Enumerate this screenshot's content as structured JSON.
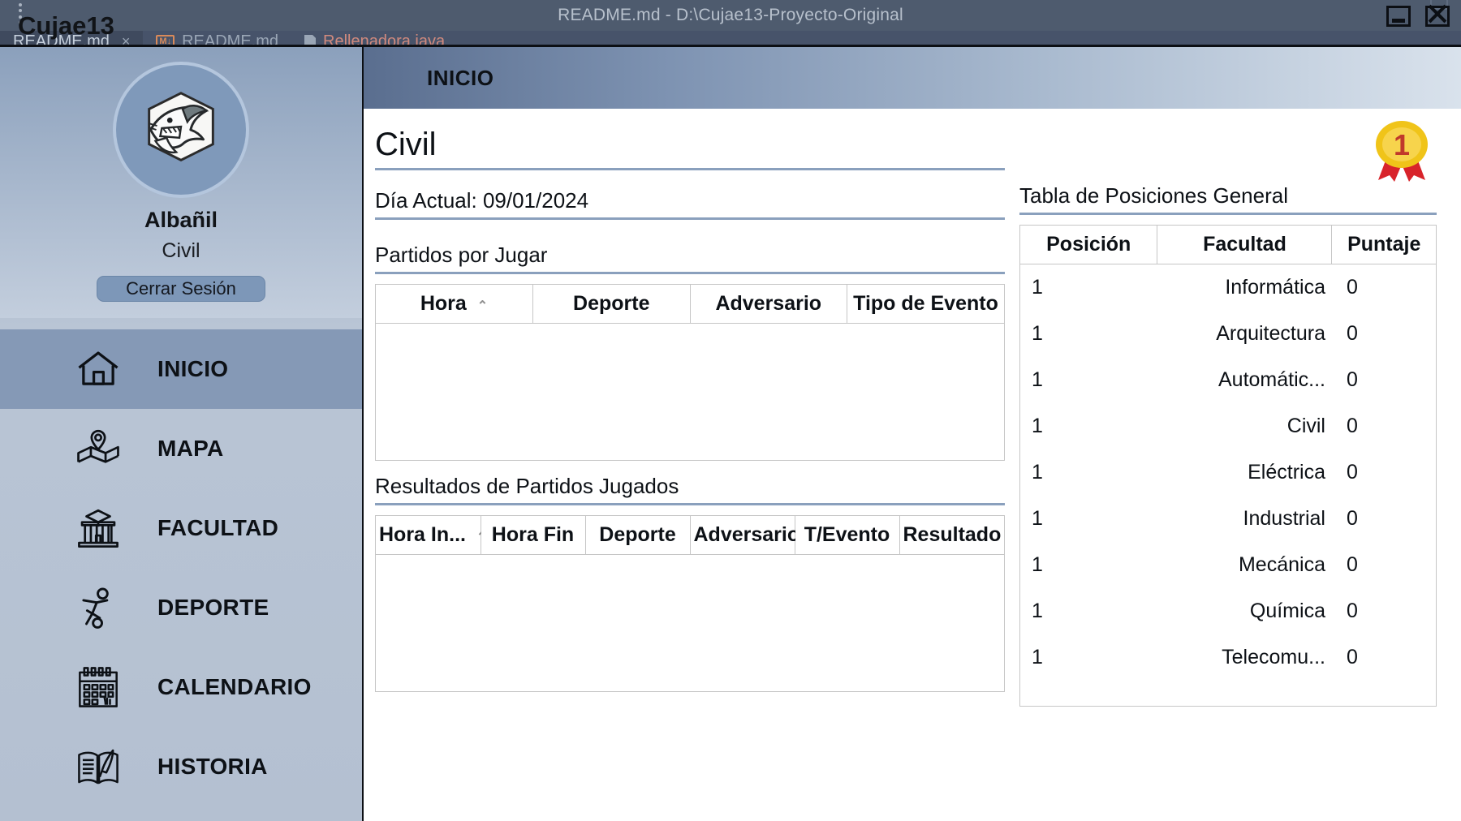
{
  "ide": {
    "title": "README.md - D:\\Cujae13-Proyecto-Original",
    "project_label": "Cujae13",
    "kebab_icon": "more-vertical-icon",
    "window_buttons": {
      "minimize": "minimize-icon",
      "close": "close-icon"
    },
    "tabs": [
      {
        "label": "README.md",
        "icon": "",
        "close": "×",
        "active": true
      },
      {
        "label": "README.md",
        "icon": "md-icon",
        "close": "",
        "active": false
      },
      {
        "label": "Rellenadora.java",
        "icon": "java-file-icon",
        "close": "",
        "active": false
      }
    ]
  },
  "sidebar": {
    "avatar_icon": "shark-logo",
    "profile_name": "Albañil",
    "profile_faculty": "Civil",
    "logout_label": "Cerrar Sesión",
    "items": [
      {
        "label": "INICIO",
        "icon": "home-icon",
        "active": true
      },
      {
        "label": "MAPA",
        "icon": "map-icon",
        "active": false
      },
      {
        "label": "FACULTAD",
        "icon": "university-icon",
        "active": false
      },
      {
        "label": "DEPORTE",
        "icon": "soccer-player-icon",
        "active": false
      },
      {
        "label": "CALENDARIO",
        "icon": "calendar-icon",
        "active": false
      },
      {
        "label": "HISTORIA",
        "icon": "book-quill-icon",
        "active": false
      }
    ]
  },
  "content": {
    "header_title": "INICIO",
    "page_title": "Civil",
    "current_day": "Día Actual: 09/01/2024",
    "medal_icon": "gold-medal-icon",
    "medal_number": "1",
    "partidos_por_jugar": {
      "heading": "Partidos por Jugar",
      "columns": [
        "Hora",
        "Deporte",
        "Adversario",
        "Tipo de Evento"
      ],
      "sort_column": "Hora",
      "sort_caret": "⌃",
      "rows": []
    },
    "resultados": {
      "heading": "Resultados de Partidos Jugados",
      "columns": [
        "Hora In...",
        "Hora Fin",
        "Deporte",
        "Adversario",
        "T/Evento",
        "Resultado"
      ],
      "sort_column": "Hora In...",
      "sort_caret": "⌃",
      "rows": []
    },
    "tabla_posiciones": {
      "heading": "Tabla de Posiciones General",
      "columns": [
        "Posición",
        "Facultad",
        "Puntaje"
      ],
      "rows": [
        {
          "posicion": "1",
          "facultad": "Informática",
          "puntaje": "0"
        },
        {
          "posicion": "1",
          "facultad": "Arquitectura",
          "puntaje": "0"
        },
        {
          "posicion": "1",
          "facultad": "Automátic...",
          "puntaje": "0"
        },
        {
          "posicion": "1",
          "facultad": "Civil",
          "puntaje": "0"
        },
        {
          "posicion": "1",
          "facultad": "Eléctrica",
          "puntaje": "0"
        },
        {
          "posicion": "1",
          "facultad": "Industrial",
          "puntaje": "0"
        },
        {
          "posicion": "1",
          "facultad": "Mecánica",
          "puntaje": "0"
        },
        {
          "posicion": "1",
          "facultad": "Química",
          "puntaje": "0"
        },
        {
          "posicion": "1",
          "facultad": "Telecomu...",
          "puntaje": "0"
        }
      ]
    }
  },
  "colors": {
    "sidebar_top": "#8ba0bc",
    "sidebar_bottom": "#b4c0d1",
    "nav_active": "#8599b6",
    "rule": "#8aa0bd",
    "ide_chrome": "#4e5b6e",
    "medal_gold": "#f0c419",
    "medal_ribbon": "#d8232a"
  }
}
